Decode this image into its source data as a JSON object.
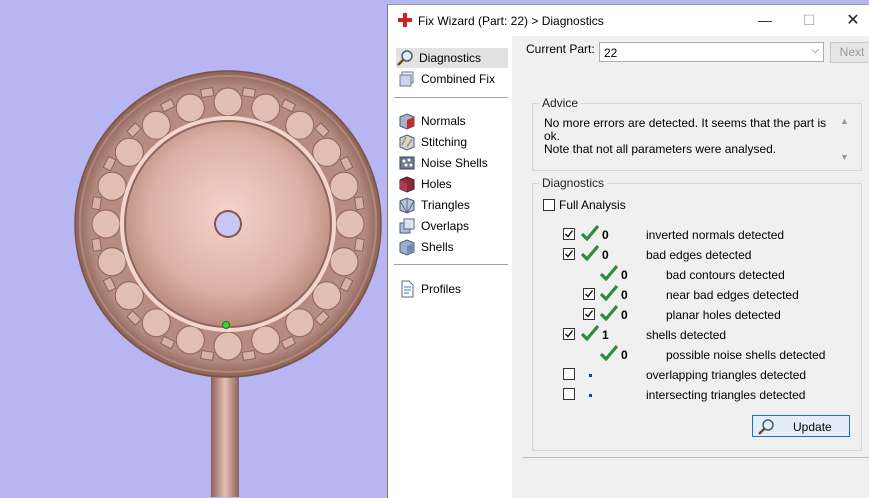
{
  "window": {
    "title": "Fix Wizard (Part: 22) > Diagnostics",
    "controls": {
      "minimize": "—",
      "maximize": "☐",
      "close": "✕"
    }
  },
  "nav": {
    "items": [
      {
        "label": "Diagnostics",
        "icon": "magnifier-icon",
        "selected": true
      },
      {
        "label": "Combined Fix",
        "icon": "combined-fix-icon"
      },
      {
        "label": "Normals",
        "icon": "normals-cube-icon"
      },
      {
        "label": "Stitching",
        "icon": "stitching-icon"
      },
      {
        "label": "Noise Shells",
        "icon": "noise-shells-icon"
      },
      {
        "label": "Holes",
        "icon": "holes-cube-icon"
      },
      {
        "label": "Triangles",
        "icon": "triangles-icon"
      },
      {
        "label": "Overlaps",
        "icon": "overlaps-icon"
      },
      {
        "label": "Shells",
        "icon": "shells-icon"
      },
      {
        "label": "Profiles",
        "icon": "profiles-doc-icon"
      }
    ]
  },
  "current_part": {
    "label": "Current Part:",
    "value": "22"
  },
  "next_button": "Next",
  "advice": {
    "title": "Advice",
    "line1": "No more errors are detected. It seems that the part is ok.",
    "line2": "Note that not all parameters were analysed."
  },
  "diagnostics": {
    "title": "Diagnostics",
    "full_analysis": "Full Analysis",
    "rows": [
      {
        "checked": true,
        "status": "ok",
        "count": "0",
        "label": "inverted normals detected"
      },
      {
        "checked": true,
        "status": "ok",
        "count": "0",
        "label": "bad edges detected"
      },
      {
        "status": "ok",
        "count": "0",
        "label": "bad contours detected"
      },
      {
        "checked": true,
        "status": "ok",
        "count": "0",
        "label": "near bad edges detected"
      },
      {
        "checked": true,
        "status": "ok",
        "count": "0",
        "label": "planar holes detected"
      },
      {
        "checked": true,
        "status": "ok",
        "count": "1",
        "label": "shells detected"
      },
      {
        "status": "ok",
        "count": "0",
        "label": "possible noise shells detected"
      },
      {
        "checked": false,
        "status": "dot",
        "label": "overlapping triangles detected"
      },
      {
        "checked": false,
        "status": "dot",
        "label": "intersecting triangles detected"
      }
    ]
  },
  "update_button": "Update",
  "colors": {
    "viewport_bg": "#b7b6f2",
    "part_color": "#c89c90",
    "ok_green": "#2d8c3c",
    "accent_blue": "#1b6fc9"
  }
}
